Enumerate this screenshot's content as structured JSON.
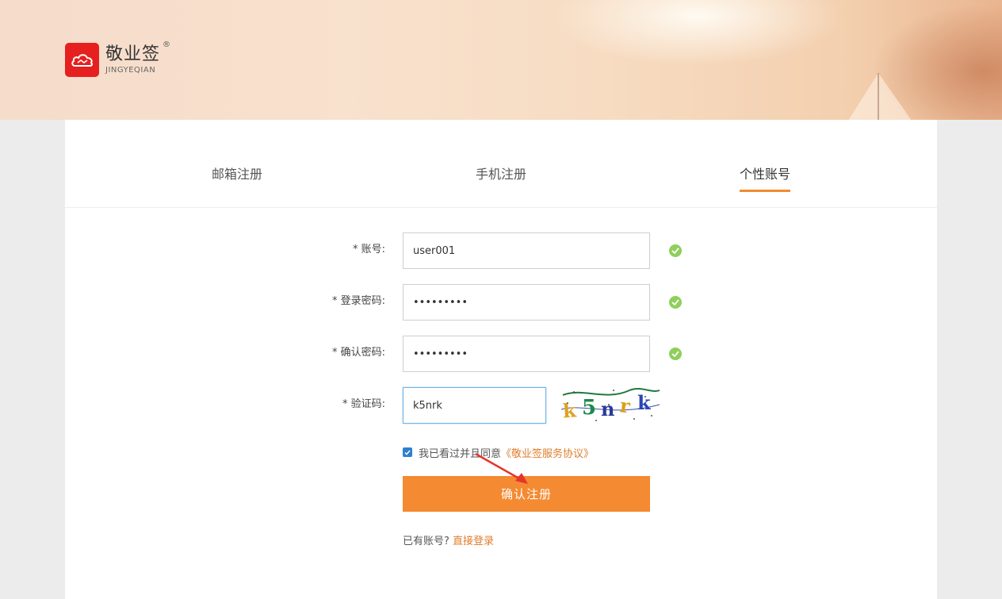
{
  "brand": {
    "name_cn": "敬业签",
    "name_en": "JINGYEQIAN",
    "registered": "®",
    "color": "#e6201e"
  },
  "tabs": [
    {
      "label": "邮箱注册",
      "active": false
    },
    {
      "label": "手机注册",
      "active": false
    },
    {
      "label": "个性账号",
      "active": true
    }
  ],
  "form": {
    "account": {
      "label": "* 账号:",
      "value": "user001",
      "valid": true
    },
    "password": {
      "label": "* 登录密码:",
      "value": "•••••••••",
      "valid": true
    },
    "confirm": {
      "label": "* 确认密码:",
      "value": "•••••••••",
      "valid": true
    },
    "captcha": {
      "label": "* 验证码:",
      "value": "k5nrk",
      "image_text": "k5nrk"
    }
  },
  "agreement": {
    "checked": true,
    "text": "我已看过并且同意",
    "link": "《敬业签服务协议》"
  },
  "submit_label": "确认注册",
  "login": {
    "prompt": "已有账号?",
    "link": "直接登录"
  },
  "colors": {
    "accent": "#f48a31",
    "valid": "#8fcf5a",
    "link": "#e07d2a",
    "checkbox": "#2f7fd1"
  }
}
